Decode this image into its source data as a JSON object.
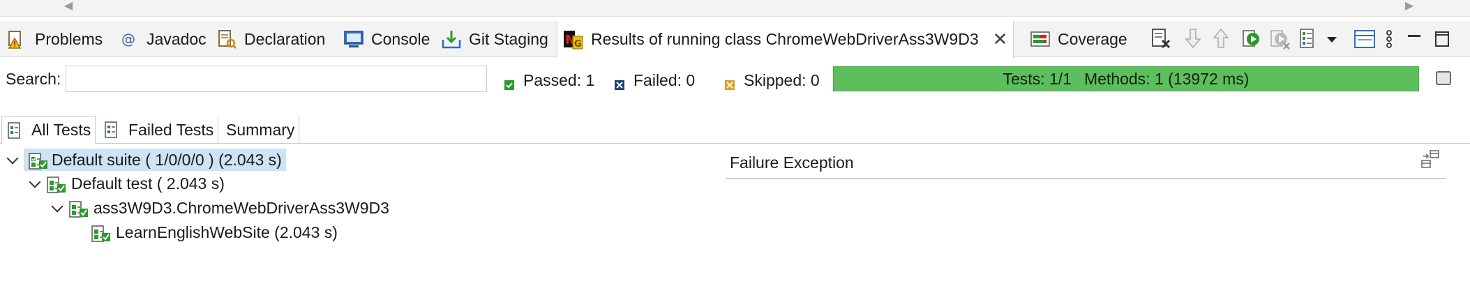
{
  "tabs": [
    {
      "label": "Problems",
      "icon": "problems-icon"
    },
    {
      "label": "Javadoc",
      "icon": "javadoc-icon"
    },
    {
      "label": "Declaration",
      "icon": "declaration-icon"
    },
    {
      "label": "Console",
      "icon": "console-icon"
    },
    {
      "label": "Git Staging",
      "icon": "git-staging-icon"
    },
    {
      "label": "Results of running class ChromeWebDriverAss3W9D3",
      "icon": "testng-icon",
      "active": true
    },
    {
      "label": "Coverage",
      "icon": "coverage-icon"
    }
  ],
  "search": {
    "label": "Search:",
    "value": "",
    "placeholder": ""
  },
  "stats": {
    "passed": "Passed: 1",
    "failed": "Failed: 0",
    "skipped": "Skipped: 0"
  },
  "progress": {
    "tests": "Tests: 1/1",
    "methods": "Methods: 1 (13972 ms)",
    "fraction": 1.0,
    "color": "#5cbf5c"
  },
  "subtabs": [
    {
      "label": "All Tests",
      "active": true
    },
    {
      "label": "Failed Tests",
      "active": false
    },
    {
      "label": "Summary",
      "active": false
    }
  ],
  "tree": {
    "suite": "Default suite ( 1/0/0/0 ) (2.043 s)",
    "test": "Default test ( 2.043 s)",
    "class": "ass3W9D3.ChromeWebDriverAss3W9D3",
    "method": "LearnEnglishWebSite  (2.043 s)"
  },
  "failure": {
    "title": "Failure Exception"
  },
  "colors": {
    "accent_green": "#5cbf5c",
    "selection": "#cde3f6"
  }
}
